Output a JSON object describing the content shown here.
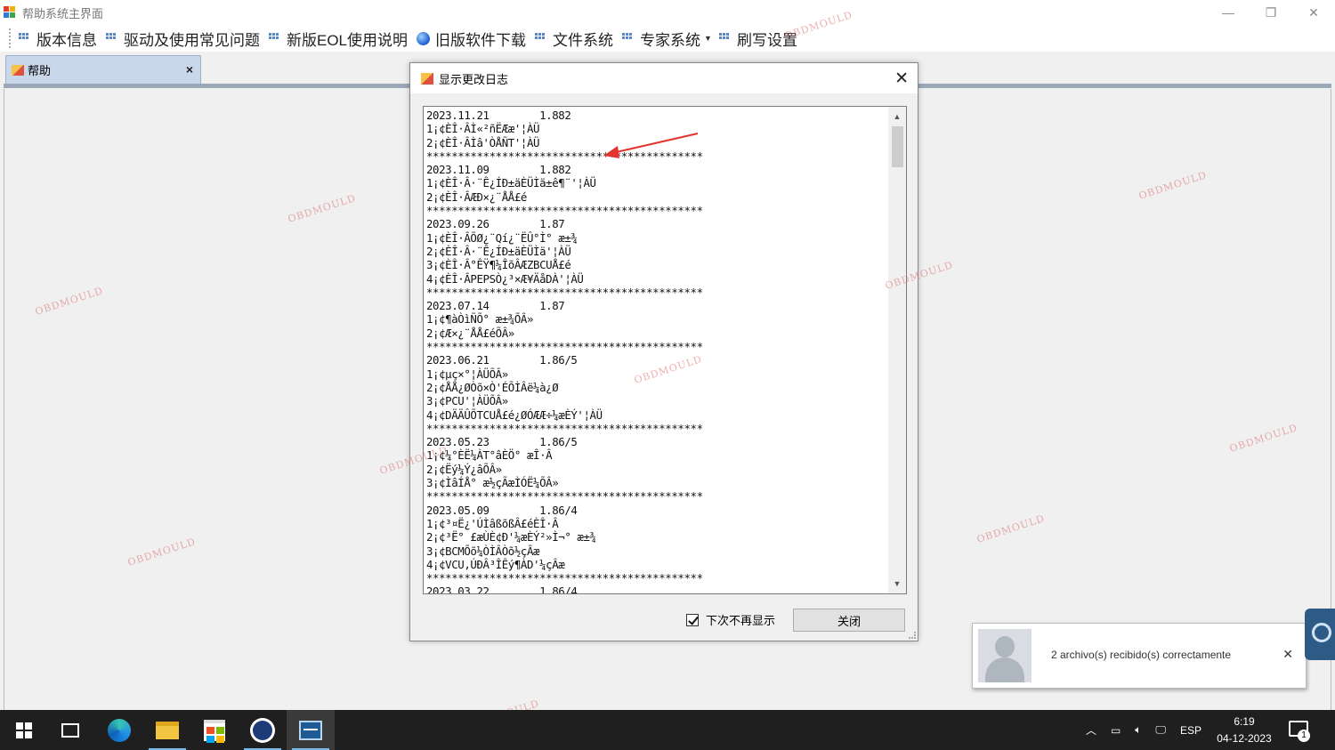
{
  "window": {
    "title": "帮助系统主界面",
    "controls": [
      "minimize-icon",
      "restore-icon",
      "close-icon"
    ]
  },
  "menu": {
    "items": [
      {
        "label": "版本信息",
        "icon": "menu-dots-icon"
      },
      {
        "label": "驱动及使用常见问题",
        "icon": "menu-dots-icon"
      },
      {
        "label": "新版EOL使用说明",
        "icon": "menu-dots-icon"
      },
      {
        "label": "旧版软件下载",
        "icon": "globe-icon"
      },
      {
        "label": "文件系统",
        "icon": "menu-dots-icon"
      },
      {
        "label": "专家系统",
        "icon": "menu-dots-icon",
        "has_dropdown": true
      },
      {
        "label": "刷写设置",
        "icon": "menu-dots-icon"
      }
    ]
  },
  "tab": {
    "label": "帮助",
    "close": "×"
  },
  "dialog": {
    "title": "显示更改日志",
    "close": "✕",
    "log_text": "2023.11.21        1.882\n1¡¢ÈÎ·ÂÌ«²ñËÆæ'¦ÀÜ\n2¡¢ÈÎ·ÂÌâ'ÒÅÑТ'¦ÀÜ\n********************************************\n2023.11.09        1.882\n1¡¢ÈÎ·Â·¨Ê¿ÍÐ±äÈÜÌä±ê¶¨'¦ÀÜ\n2¡¢ÈÎ·ÂÆÐ×¿¨ÅÅ£é\n********************************************\n2023.09.26        1.87\n1¡¢ÈÎ·ÂÕØ¿¨Qí¿¨ËÛ°Ì° æ±¾\n2¡¢ÈÎ·Â·¨Ê¿ÍÐ±äÈÜÌä'¦ÀÜ\n3¡¢ÈÎ·Â°ÊŸ¶¼ÎõÂÆZBCUÅ£é\n4¡¢ÈÎ·ÂPEPSÒ¿³×Æ¥ÄåDÀ'¦ÀÜ\n********************************************\n2023.07.14        1.87\n1¡¢¶àÒìÑÕ° æ±¾ÕÂ»\n2¡¢Æ×¿¨ÅÅ£éÕÂ»\n********************************************\n2023.06.21        1.86/5\n1¡¢µç×°¦ÀÜÕÂ»\n2¡¢ÅÅ¿ØÒõ×Ò'ÉÕÌÂë¼à¿Ø\n3¡¢PCU'¦ÀÜÕÂ»\n4¡¢DÄÄÛÕTCUÅ£é¿ØÓÆÆ÷¼æÈÝ'¦ÀÜ\n********************************************\n2023.05.23        1.86/5\n1¡¢¼°ÈË¼ÀТ°âÈÖ° æÎ·Â\n2¡¢Ëý¼Ý¿âÕÂ»\n3¡¢ÌâÍÅ° æ½çÃæÌÓË¼ÕÂ»\n********************************************\n2023.05.09        1.86/4\n1¡¢³¤Ë¿'ÚÌâßõßÂ£éÈÎ·Â\n2¡¢³Ë° £æÙÈ¢Ð'¼æÈÝ²»Ì¬° æ±¾\n3¡¢BCMÕõ¼ÒÌÂÒõ½çÂæ\n4¡¢VCU,ÚÐÂ³ÎÊý¶ÀD'¼çÂæ\n********************************************\n2023.03.22        1.86/4",
    "dont_show_again": "下次不再显示",
    "dont_show_checked": true,
    "close_button": "关闭",
    "scroll_up": "▲",
    "scroll_down": "▼"
  },
  "notification": {
    "text": "2 archivo(s) recibido(s) correctamente",
    "close": "✕"
  },
  "taskbar": {
    "apps": [
      "windows-start-icon",
      "task-view-icon",
      "edge-icon",
      "file-explorer-icon",
      "store-icon",
      "teamviewer-icon",
      "help-app-icon"
    ],
    "language": "ESP",
    "time": "6:19",
    "date": "04-12-2023",
    "notification_count": "1"
  },
  "watermark": "OBDMOULD"
}
